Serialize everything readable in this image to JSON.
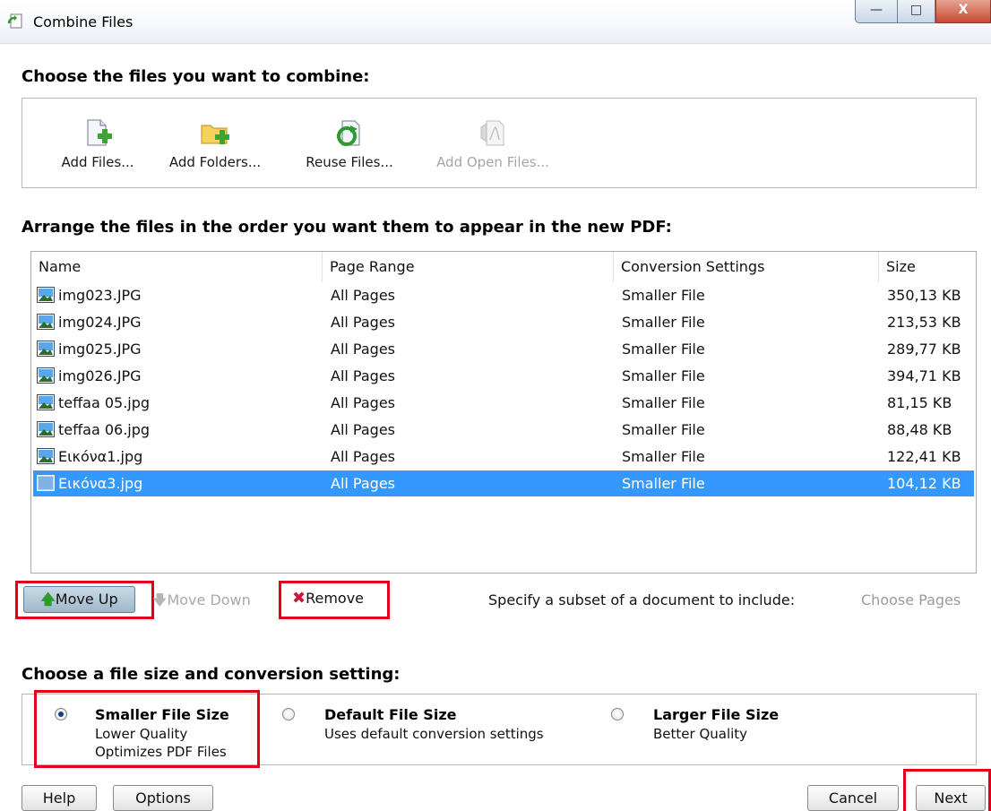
{
  "window": {
    "title": "Combine Files",
    "controls": {
      "minimize": "—",
      "maximize": "□",
      "close": "X"
    }
  },
  "choose_section": {
    "heading": "Choose the files you want to combine:",
    "tools": [
      {
        "label": "Add Files...",
        "icon": "add-file-icon",
        "enabled": true
      },
      {
        "label": "Add Folders...",
        "icon": "add-folder-icon",
        "enabled": true
      },
      {
        "label": "Reuse Files...",
        "icon": "reuse-files-icon",
        "enabled": true
      },
      {
        "label": "Add Open Files...",
        "icon": "add-open-files-icon",
        "enabled": false
      }
    ]
  },
  "arrange_section": {
    "heading": "Arrange the files in the order you want them to appear in the new PDF:",
    "columns": [
      "Name",
      "Page Range",
      "Conversion Settings",
      "Size"
    ],
    "rows": [
      {
        "name": "img023.JPG",
        "page_range": "All Pages",
        "conversion": "Smaller File",
        "size": "350,13 KB"
      },
      {
        "name": "img024.JPG",
        "page_range": "All Pages",
        "conversion": "Smaller File",
        "size": "213,53 KB"
      },
      {
        "name": "img025.JPG",
        "page_range": "All Pages",
        "conversion": "Smaller File",
        "size": "289,77 KB"
      },
      {
        "name": "img026.JPG",
        "page_range": "All Pages",
        "conversion": "Smaller File",
        "size": "394,71 KB"
      },
      {
        "name": "teffaa 05.jpg",
        "page_range": "All Pages",
        "conversion": "Smaller File",
        "size": "81,15 KB"
      },
      {
        "name": "teffaa 06.jpg",
        "page_range": "All Pages",
        "conversion": "Smaller File",
        "size": "88,48 KB"
      },
      {
        "name": "Εικόνα1.jpg",
        "page_range": "All Pages",
        "conversion": "Smaller File",
        "size": "122,41 KB"
      },
      {
        "name": "Εικόνα3.jpg",
        "page_range": "All Pages",
        "conversion": "Smaller File",
        "size": "104,12 KB",
        "selected": true
      }
    ],
    "buttons": {
      "move_up": "Move Up",
      "move_down": "Move Down",
      "remove": "Remove",
      "subset_text": "Specify a subset of a document to include:",
      "choose_pages": "Choose Pages"
    }
  },
  "size_section": {
    "heading": "Choose a file size and conversion setting:",
    "options": [
      {
        "title": "Smaller File Size",
        "lines": [
          "Lower Quality",
          "Optimizes PDF Files"
        ],
        "checked": true
      },
      {
        "title": "Default File Size",
        "lines": [
          "Uses default conversion settings"
        ],
        "checked": false
      },
      {
        "title": "Larger File Size",
        "lines": [
          "Better Quality"
        ],
        "checked": false
      }
    ]
  },
  "footer": {
    "help": "Help",
    "options": "Options",
    "cancel": "Cancel",
    "next": "Next"
  },
  "colors": {
    "selection": "#3399ff",
    "highlight_box": "#e0001a",
    "move_up_arrow": "#2a9d2a",
    "remove_x": "#d0143c"
  }
}
